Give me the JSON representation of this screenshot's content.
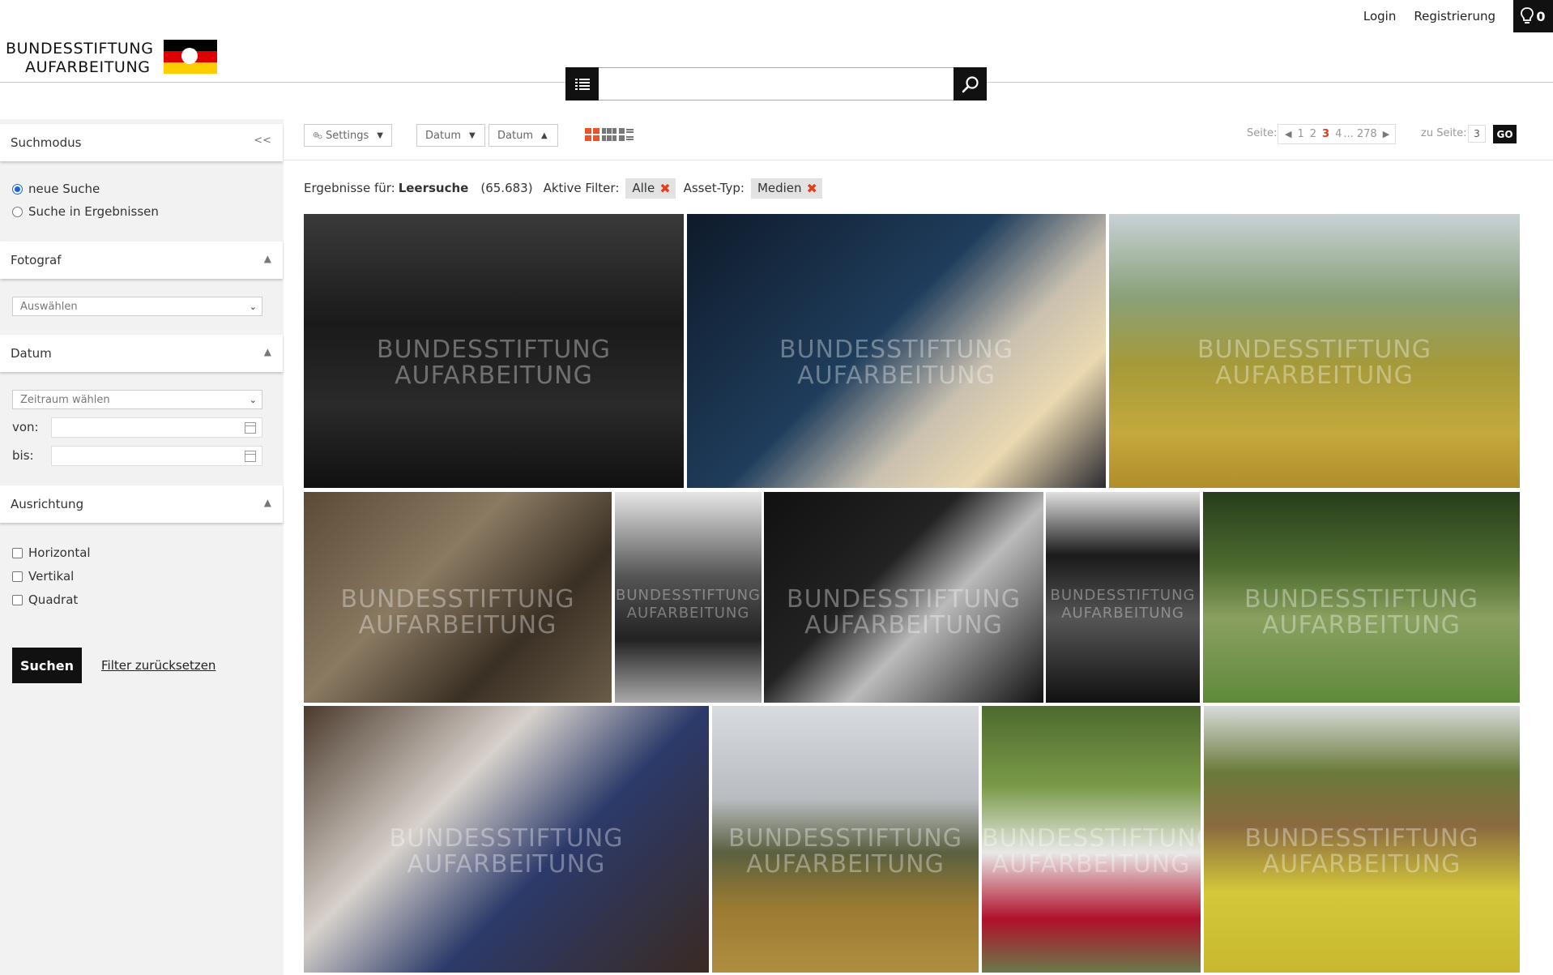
{
  "topnav": {
    "login": "Login",
    "register": "Registrierung",
    "lightbox_count": "0"
  },
  "logo": {
    "line1": "BUNDESSTIFTUNG",
    "line2": "AUFARBEITUNG"
  },
  "search": {
    "placeholder": "",
    "value": ""
  },
  "sidebar": {
    "suchmodus": {
      "title": "Suchmodus",
      "collapse": "<<",
      "options": [
        "neue Suche",
        "Suche in Ergebnissen"
      ],
      "selected": 0
    },
    "fotograf": {
      "title": "Fotograf",
      "select": "Auswählen"
    },
    "datum": {
      "title": "Datum",
      "select": "Zeitraum wählen",
      "from_label": "von:",
      "to_label": "bis:"
    },
    "ausrichtung": {
      "title": "Ausrichtung",
      "options": [
        "Horizontal",
        "Vertikal",
        "Quadrat"
      ]
    },
    "search_button": "Suchen",
    "reset_link": "Filter zurücksetzen"
  },
  "toolbar": {
    "settings": "Settings",
    "sort1": "Datum",
    "sort2": "Datum",
    "page_label": "Seite:",
    "pages": [
      "1",
      "2",
      "3",
      "4",
      "... 278"
    ],
    "current_page": "3",
    "goto_label": "zu Seite:",
    "goto_value": "3",
    "go": "GO"
  },
  "filters": {
    "results_prefix": "Ergebnisse für:",
    "query": "Leersuche",
    "count": "(65.683)",
    "active_label": "Aktive Filter:",
    "chip1": "Alle",
    "asset_label": "Asset-Typ:",
    "chip2": "Medien"
  },
  "watermark": {
    "line1": "BUNDESSTIFTUNG",
    "line2": "AUFARBEITUNG"
  },
  "images": [
    {
      "name": "photo-soldiers-group",
      "bg": "linear-gradient(180deg,#3a3a3a 0%,#1a1a1a 40%,#2a2a2a 70%,#111 100%)"
    },
    {
      "name": "photo-egg-factory",
      "bg": "linear-gradient(135deg,#0e1a2a 0%,#1f3d5c 45%,#c9c0b0 65%,#ead8b0 80%,#2a2a30 100%)"
    },
    {
      "name": "photo-harvester-field",
      "bg": "linear-gradient(180deg,#c8d2d6 0%,#8aa17a 30%,#a59a3a 55%,#c4a93c 80%,#b08e2a 100%)"
    },
    {
      "name": "photo-mill-interior",
      "bg": "linear-gradient(135deg,#5b4a36 0%,#8a7a62 40%,#3a3024 70%,#6a5c48 100%)"
    },
    {
      "name": "photo-officers-banner",
      "bg": "linear-gradient(180deg,#e6e6e6 0%,#555 40%,#222 70%,#aaa 100%)"
    },
    {
      "name": "photo-guitar-singer",
      "bg": "linear-gradient(135deg,#111 0%,#222 40%,#bbb 60%,#111 100%)"
    },
    {
      "name": "photo-general-portrait",
      "bg": "linear-gradient(180deg,#e0e0e0 0%,#1a1a1a 30%,#555 60%,#111 100%)"
    },
    {
      "name": "photo-trabant-garden",
      "bg": "linear-gradient(180deg,#263e1c 0%,#4d6a2e 35%,#8aa060 60%,#5f8a3a 100%)"
    },
    {
      "name": "photo-family-portrait",
      "bg": "linear-gradient(135deg,#4b3a2c 0%,#d8d2cc 35%,#2c3a6a 60%,#3a2a22 100%)"
    },
    {
      "name": "photo-tractor-field",
      "bg": "linear-gradient(180deg,#d8dce0 0%,#b8bcc0 35%,#5a6040 55%,#9a7a32 75%,#b08e40 100%)"
    },
    {
      "name": "photo-cherry-harvest",
      "bg": "linear-gradient(180deg,#4d6a2e 0%,#7a9a48 30%,#e8e8e8 55%,#b0102a 80%,#6a7a4a 100%)"
    },
    {
      "name": "photo-apple-crates",
      "bg": "linear-gradient(180deg,#d8dcdc 0%,#6a7a3a 25%,#8a6a40 45%,#d4c83a 70%,#c8b830 100%)"
    }
  ]
}
